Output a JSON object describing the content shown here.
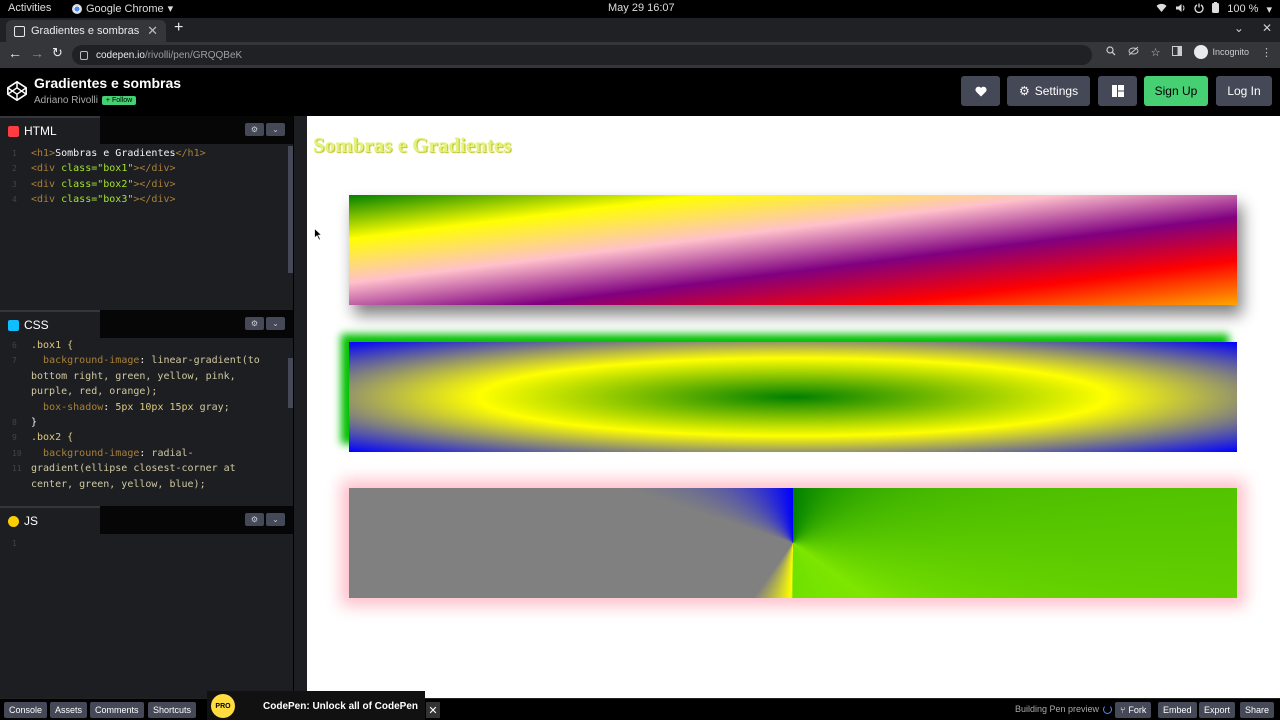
{
  "system": {
    "activities": "Activities",
    "app_name": "Google Chrome",
    "clock": "May 29  16:07",
    "battery": "100 %"
  },
  "browser": {
    "tab_title": "Gradientes e sombras",
    "url_host": "codepen.io",
    "url_path": "/rivolli/pen/GRQQBeK",
    "incognito_label": "Incognito"
  },
  "codepen": {
    "pen_title": "Gradientes e sombras",
    "author": "Adriano Rivolli",
    "follow_label": "+ Follow",
    "settings_label": "Settings",
    "signup_label": "Sign Up",
    "login_label": "Log In"
  },
  "editors": {
    "html": {
      "label": "HTML",
      "lines": [
        {
          "n": "1"
        },
        {
          "n": "2"
        },
        {
          "n": "3"
        },
        {
          "n": "4"
        }
      ],
      "t": {
        "l1_open": "<h1>",
        "l1_text": "Sombras e Gradientes",
        "l1_close": "</h1>",
        "div_open": "<div",
        "cls_attr": " class=",
        "box1": "\"box1\"",
        "box2": "\"box2\"",
        "box3": "\"box3\"",
        "div_close": "></div>"
      }
    },
    "css": {
      "label": "CSS",
      "ln": [
        "6",
        "7",
        "",
        "",
        "",
        "8",
        "9",
        "10",
        "11",
        "",
        "",
        ""
      ],
      "t": {
        "sel1": ".box1 {",
        "prop1": "background-image",
        "val1a": "linear-gradient(to",
        "val1b": "bottom right, green, yellow, pink,",
        "val1c": "purple, red, orange);",
        "prop2": "box-shadow",
        "val2_nums": "5px 10px 15px",
        "val2_color": " gray;",
        "close": "}",
        "sel2": ".box2 {",
        "prop3": "background-image",
        "val3a": "radial-",
        "val3b": "gradient(ellipse closest-corner at",
        "val3c": "center, green, yellow, blue);"
      }
    },
    "js": {
      "label": "JS",
      "ln": [
        "1"
      ]
    }
  },
  "preview": {
    "heading": "Sombras e Gradientes"
  },
  "bottombar": {
    "console": "Console",
    "assets": "Assets",
    "comments": "Comments",
    "shortcuts": "Shortcuts",
    "pro_badge": "PRO",
    "promo_text": "CodePen: Unlock all of CodePen",
    "status": "Building Pen preview",
    "fork": "Fork",
    "embed": "Embed",
    "export": "Export",
    "share": "Share"
  },
  "colors": {
    "signup_green": "#47cf73",
    "heading_yellow": "#e2f27a",
    "editor_bg": "#1d1e22"
  }
}
